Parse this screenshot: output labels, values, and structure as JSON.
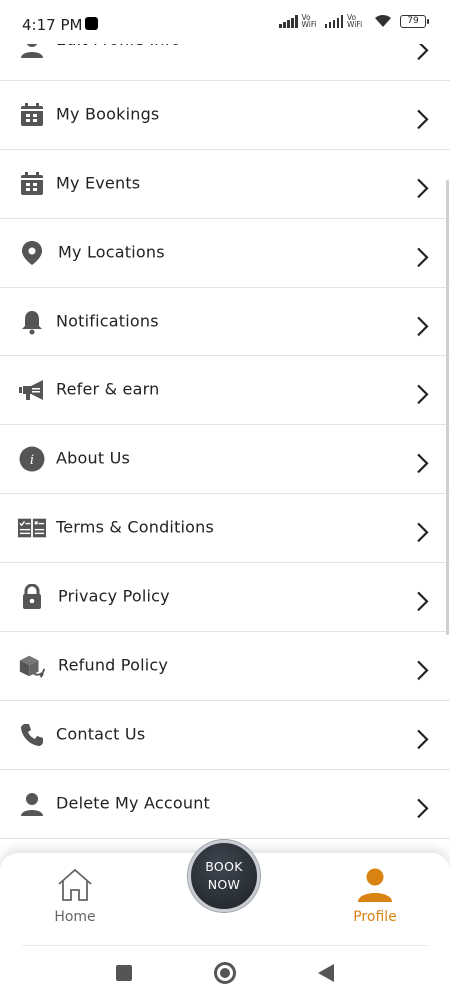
{
  "status_bar": {
    "time": "4:17 PM",
    "network_1": "Vo WiFi",
    "network_2": "Vo WiFi",
    "battery": "79"
  },
  "menu": {
    "items": [
      {
        "label": "Edit Profile Info",
        "icon": "person-icon"
      },
      {
        "label": "My Bookings",
        "icon": "calendar-icon"
      },
      {
        "label": "My Events",
        "icon": "calendar-icon"
      },
      {
        "label": "My Locations",
        "icon": "location-pin-icon"
      },
      {
        "label": "Notifications",
        "icon": "bell-icon"
      },
      {
        "label": "Refer & earn",
        "icon": "megaphone-icon"
      },
      {
        "label": "About Us",
        "icon": "info-icon"
      },
      {
        "label": "Terms & Conditions",
        "icon": "checklist-icon"
      },
      {
        "label": "Privacy Policy",
        "icon": "lock-icon"
      },
      {
        "label": "Refund Policy",
        "icon": "refund-box-icon"
      },
      {
        "label": "Contact Us",
        "icon": "phone-icon"
      },
      {
        "label": "Delete My Account",
        "icon": "person-icon"
      }
    ]
  },
  "bottom_nav": {
    "home_label": "Home",
    "profile_label": "Profile",
    "book_now_line1": "BOOK",
    "book_now_line2": "NOW",
    "active_tab": "Profile",
    "accent_color": "#d98312"
  }
}
